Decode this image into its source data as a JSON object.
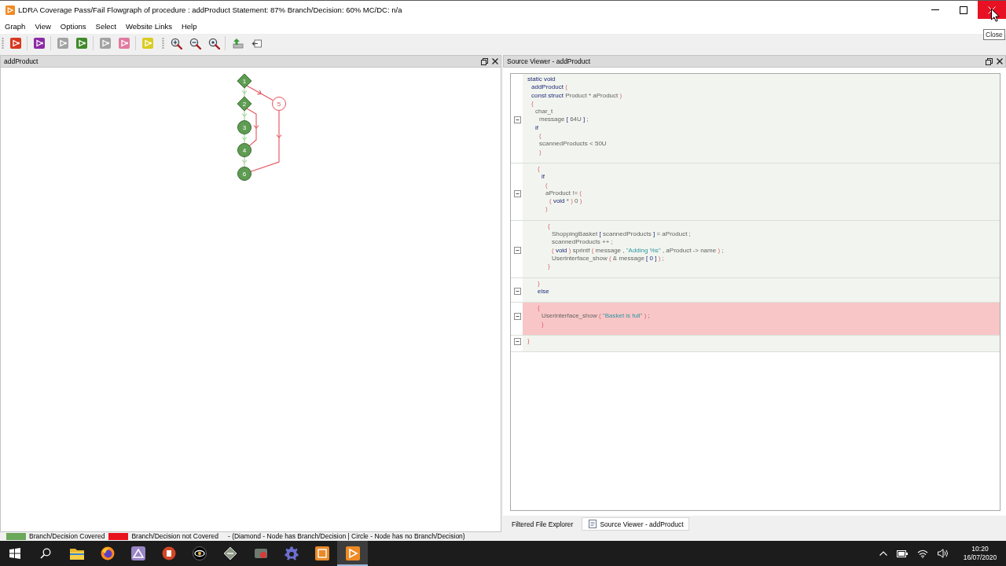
{
  "window": {
    "title": "LDRA Coverage Pass/Fail Flowgraph of procedure : addProduct Statement: 87% Branch/Decision: 60% MC/DC: n/a",
    "controls": [
      {
        "kind": "minimize",
        "hovered": false
      },
      {
        "kind": "maximize",
        "hovered": false
      },
      {
        "kind": "close",
        "hovered": true
      }
    ],
    "tooltip": "Close"
  },
  "menu": [
    "Graph",
    "View",
    "Options",
    "Select",
    "Website Links",
    "Help"
  ],
  "toolbars": [
    {
      "groups": [
        {
          "buttons": [
            {
              "kind": "flowgraph",
              "color": "#d9361f"
            }
          ]
        },
        {
          "buttons": [
            {
              "kind": "flowgraph",
              "color": "#8c2aa5"
            }
          ]
        },
        {
          "buttons": [
            {
              "kind": "flowgraph",
              "color": "#a3a3a3"
            },
            {
              "kind": "flowgraph",
              "color": "#3f8a2b"
            }
          ]
        },
        {
          "buttons": [
            {
              "kind": "flowgraph",
              "color": "#a3a3a3"
            },
            {
              "kind": "flowgraph",
              "color": "#e07aa0"
            }
          ]
        },
        {
          "buttons": [
            {
              "kind": "flowgraph",
              "color": "#d9cc1f"
            }
          ]
        }
      ]
    },
    {
      "groups": [
        {
          "buttons": [
            {
              "kind": "zoom-in"
            },
            {
              "kind": "zoom-out"
            },
            {
              "kind": "zoom-fit"
            }
          ]
        },
        {
          "buttons": [
            {
              "kind": "up"
            },
            {
              "kind": "back"
            }
          ]
        }
      ]
    }
  ],
  "graph_panel": {
    "title": "addProduct",
    "nodes": [
      {
        "label": "1",
        "kind": "diamond",
        "covered": true
      },
      {
        "label": "2",
        "kind": "diamond",
        "covered": true
      },
      {
        "label": "5",
        "kind": "circle",
        "covered": false
      },
      {
        "label": "3",
        "kind": "circle",
        "covered": true
      },
      {
        "label": "4",
        "kind": "circle",
        "covered": true
      },
      {
        "label": "6",
        "kind": "circle",
        "covered": true
      }
    ],
    "edges": [
      {
        "covered": true
      },
      {
        "covered": true
      },
      {
        "covered": true
      },
      {
        "covered": true
      },
      {
        "covered": false
      },
      {
        "covered": false
      },
      {
        "covered": false
      }
    ]
  },
  "source_panel": {
    "title": "Source Viewer - addProduct",
    "blocks": [
      {
        "covered": true,
        "lines": [
          {
            "fold": false,
            "tokens": [
              {
                "text": "static void",
                "kind": "keyword"
              }
            ],
            "children": [
              {
                "fold": false,
                "tokens": [
                  {
                    "text": "addProduct",
                    "kind": "keyword"
                  },
                  {
                    "text": " (",
                    "kind": "paren"
                  }
                ]
              },
              {
                "fold": false,
                "tokens": [
                  {
                    "text": "const struct",
                    "kind": "keyword"
                  },
                  {
                    "text": " Product * aProduct",
                    "kind": "plain"
                  },
                  {
                    "text": " )",
                    "kind": "paren"
                  }
                ]
              },
              {
                "fold": false,
                "tokens": [
                  {
                    "text": "{",
                    "kind": "paren"
                  }
                ],
                "children": [
                  {
                    "fold": false,
                    "tokens": [
                      {
                        "text": "char_t",
                        "kind": "plain"
                      }
                    ],
                    "children": [
                      {
                        "fold": true,
                        "tokens": [
                          {
                            "text": "message ",
                            "kind": "plain"
                          },
                          {
                            "text": "[",
                            "kind": "bracket"
                          },
                          {
                            "text": " 64U ",
                            "kind": "plain"
                          },
                          {
                            "text": "]",
                            "kind": "bracket"
                          },
                          {
                            "text": " ;",
                            "kind": "plain"
                          }
                        ]
                      }
                    ]
                  },
                  {
                    "fold": false,
                    "tokens": [
                      {
                        "text": "if",
                        "kind": "keyword"
                      }
                    ],
                    "children": [
                      {
                        "fold": false,
                        "tokens": [
                          {
                            "text": "(",
                            "kind": "paren"
                          }
                        ]
                      },
                      {
                        "fold": false,
                        "tokens": [
                          {
                            "text": "scannedProducts < 50U",
                            "kind": "plain"
                          }
                        ]
                      },
                      {
                        "fold": false,
                        "tokens": [
                          {
                            "text": ")",
                            "kind": "paren"
                          }
                        ]
                      }
                    ]
                  }
                ]
              }
            ]
          }
        ],
        "children": [
          {
            "covered": true,
            "lines": [
              {
                "fold": false,
                "tokens": [
                  {
                    "text": "{",
                    "kind": "paren"
                  }
                ],
                "children": [
                  {
                    "fold": false,
                    "tokens": [
                      {
                        "text": "if",
                        "kind": "keyword"
                      }
                    ],
                    "children": [
                      {
                        "fold": false,
                        "tokens": [
                          {
                            "text": "(",
                            "kind": "paren"
                          }
                        ]
                      },
                      {
                        "fold": true,
                        "tokens": [
                          {
                            "text": "aProduct != ",
                            "kind": "plain"
                          },
                          {
                            "text": "(",
                            "kind": "paren"
                          }
                        ],
                        "children": [
                          {
                            "fold": false,
                            "tokens": [
                              {
                                "text": "(",
                                "kind": "paren"
                              },
                              {
                                "text": " void",
                                "kind": "keyword"
                              },
                              {
                                "text": " * ",
                                "kind": "plain"
                              },
                              {
                                "text": ")",
                                "kind": "paren"
                              },
                              {
                                "text": " 0 ",
                                "kind": "plain"
                              },
                              {
                                "text": ")",
                                "kind": "paren"
                              }
                            ]
                          }
                        ]
                      },
                      {
                        "fold": false,
                        "tokens": [
                          {
                            "text": ")",
                            "kind": "paren"
                          }
                        ]
                      }
                    ]
                  }
                ]
              }
            ],
            "children": [
              {
                "covered": true,
                "lines": [
                  {
                    "fold": false,
                    "tokens": [
                      {
                        "text": "{",
                        "kind": "paren"
                      }
                    ],
                    "children": [
                      {
                        "fold": false,
                        "tokens": [
                          {
                            "text": "ShoppingBasket ",
                            "kind": "plain"
                          },
                          {
                            "text": "[",
                            "kind": "bracket"
                          },
                          {
                            "text": " scannedProducts ",
                            "kind": "plain"
                          },
                          {
                            "text": "]",
                            "kind": "bracket"
                          },
                          {
                            "text": " = aProduct ;",
                            "kind": "plain"
                          }
                        ]
                      },
                      {
                        "fold": false,
                        "tokens": [
                          {
                            "text": "scannedProducts ++ ;",
                            "kind": "plain"
                          }
                        ]
                      },
                      {
                        "fold": true,
                        "tokens": [
                          {
                            "text": "(",
                            "kind": "paren"
                          },
                          {
                            "text": " void ",
                            "kind": "keyword"
                          },
                          {
                            "text": ")",
                            "kind": "paren"
                          },
                          {
                            "text": " sprintf ",
                            "kind": "plain"
                          },
                          {
                            "text": "(",
                            "kind": "paren"
                          },
                          {
                            "text": " message , ",
                            "kind": "plain"
                          },
                          {
                            "text": "\"Adding %s\"",
                            "kind": "string"
                          },
                          {
                            "text": " , aProduct -> name ",
                            "kind": "plain"
                          },
                          {
                            "text": ")",
                            "kind": "paren"
                          },
                          {
                            "text": " ;",
                            "kind": "plain"
                          }
                        ]
                      },
                      {
                        "fold": false,
                        "tokens": [
                          {
                            "text": "Userinterface_show ",
                            "kind": "plain"
                          },
                          {
                            "text": "(",
                            "kind": "paren"
                          },
                          {
                            "text": " & message ",
                            "kind": "plain"
                          },
                          {
                            "text": "[ 0 ]",
                            "kind": "bracket"
                          },
                          {
                            "text": " )",
                            "kind": "paren"
                          },
                          {
                            "text": " ;",
                            "kind": "plain"
                          }
                        ]
                      }
                    ]
                  },
                  {
                    "fold": false,
                    "tokens": [
                      {
                        "text": "}",
                        "kind": "paren"
                      }
                    ]
                  }
                ]
              }
            ]
          },
          {
            "covered": true,
            "lines": [
              {
                "fold": false,
                "tokens": [
                  {
                    "text": "}",
                    "kind": "paren"
                  }
                ]
              },
              {
                "fold": true,
                "tokens": [
                  {
                    "text": "else",
                    "kind": "keyword"
                  }
                ]
              }
            ]
          },
          {
            "covered": false,
            "lines": [
              {
                "fold": false,
                "tokens": [
                  {
                    "text": "{",
                    "kind": "paren"
                  }
                ],
                "children": [
                  {
                    "fold": true,
                    "tokens": [
                      {
                        "text": "Userinterface_show ",
                        "kind": "plain"
                      },
                      {
                        "text": "( ",
                        "kind": "paren"
                      },
                      {
                        "text": "\"Basket is full\"",
                        "kind": "string"
                      },
                      {
                        "text": " )",
                        "kind": "paren"
                      },
                      {
                        "text": " ;",
                        "kind": "plain"
                      }
                    ]
                  },
                  {
                    "fold": false,
                    "tokens": [
                      {
                        "text": "}",
                        "kind": "paren"
                      }
                    ]
                  }
                ]
              }
            ]
          }
        ]
      },
      {
        "covered": true,
        "lines": [
          {
            "fold": true,
            "tokens": [
              {
                "text": "}",
                "kind": "paren"
              }
            ]
          }
        ]
      }
    ],
    "tabs": [
      {
        "label": "Filtered File Explorer",
        "kind": "explorer",
        "selected": false
      },
      {
        "label": "Source Viewer - addProduct",
        "kind": "source",
        "selected": true
      }
    ]
  },
  "legend": {
    "items": [
      {
        "label": "Branch/Decision Covered",
        "color": "#6aa85a"
      },
      {
        "label": "Branch/Decision not Covered",
        "color": "#e8141e"
      }
    ],
    "note": "- (Diamond - Node has Branch/Decision | Circle - Node has no Branch/Decision)"
  },
  "taskbar": {
    "apps": [
      {
        "kind": "folder",
        "active": false
      },
      {
        "kind": "browser",
        "active": false
      },
      {
        "kind": "tile",
        "active": false
      },
      {
        "kind": "presentation",
        "active": false
      },
      {
        "kind": "eye",
        "active": false
      },
      {
        "kind": "diamond",
        "active": false
      },
      {
        "kind": "badge",
        "active": false
      },
      {
        "kind": "gear",
        "active": false
      },
      {
        "kind": "box",
        "active": false
      },
      {
        "kind": "flowgraph",
        "active": true
      }
    ],
    "clock": {
      "time": "10:20",
      "date": "16/07/2020"
    }
  }
}
